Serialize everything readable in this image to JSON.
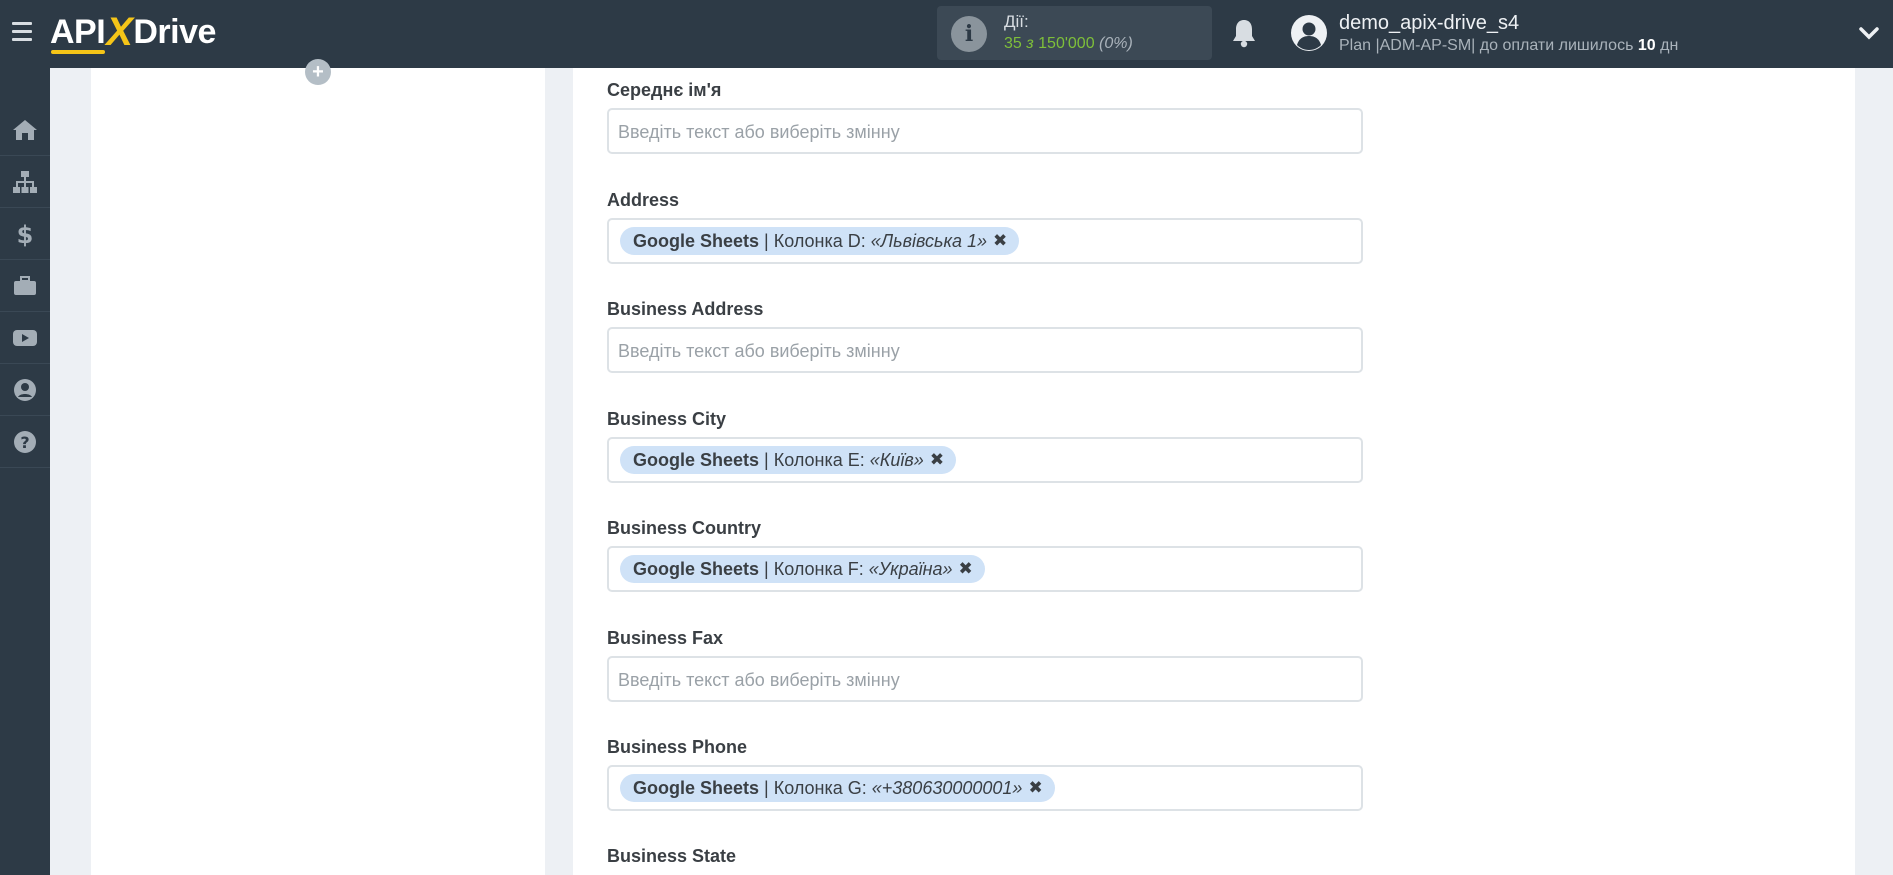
{
  "header": {
    "logo_api": "API",
    "logo_x": "X",
    "logo_drive": "Drive",
    "actions": {
      "label": "Дії:",
      "used": "35",
      "of_word": "з",
      "total": "150'000",
      "percent": "(0%)"
    },
    "user": {
      "name": "demo_apix-drive_s4",
      "plan_prefix": "Plan |ADM-AP-SM| до оплати лишилось",
      "days": "10",
      "days_unit": "дн"
    }
  },
  "sidebar": {
    "items": [
      {
        "icon": "home-icon"
      },
      {
        "icon": "sitemap-icon"
      },
      {
        "icon": "dollar-icon"
      },
      {
        "icon": "briefcase-icon"
      },
      {
        "icon": "youtube-icon"
      },
      {
        "icon": "user-circle-icon"
      },
      {
        "icon": "question-circle-icon"
      }
    ]
  },
  "left_panel": {
    "add_symbol": "+"
  },
  "form": {
    "placeholder": "Введіть текст або виберіть змінну",
    "fields": [
      {
        "label": "Середнє ім'я"
      },
      {
        "label": "Address",
        "tag": {
          "source": "Google Sheets",
          "column": "Колонка D:",
          "value": "«Львівська 1»",
          "remove": "✖"
        }
      },
      {
        "label": "Business Address"
      },
      {
        "label": "Business City",
        "tag": {
          "source": "Google Sheets",
          "column": "Колонка E:",
          "value": "«Київ»",
          "remove": "✖"
        }
      },
      {
        "label": "Business Country",
        "tag": {
          "source": "Google Sheets",
          "column": "Колонка F:",
          "value": "«Україна»",
          "remove": "✖"
        }
      },
      {
        "label": "Business Fax"
      },
      {
        "label": "Business Phone",
        "tag": {
          "source": "Google Sheets",
          "column": "Колонка G:",
          "value": "«+380630000001»",
          "remove": "✖"
        }
      },
      {
        "label": "Business State"
      }
    ]
  },
  "colors": {
    "topbar": "#2d3a46",
    "accent_yellow": "#f5c518",
    "actions_green": "#7ebf3a",
    "tag_bg": "#cfe2f7"
  }
}
